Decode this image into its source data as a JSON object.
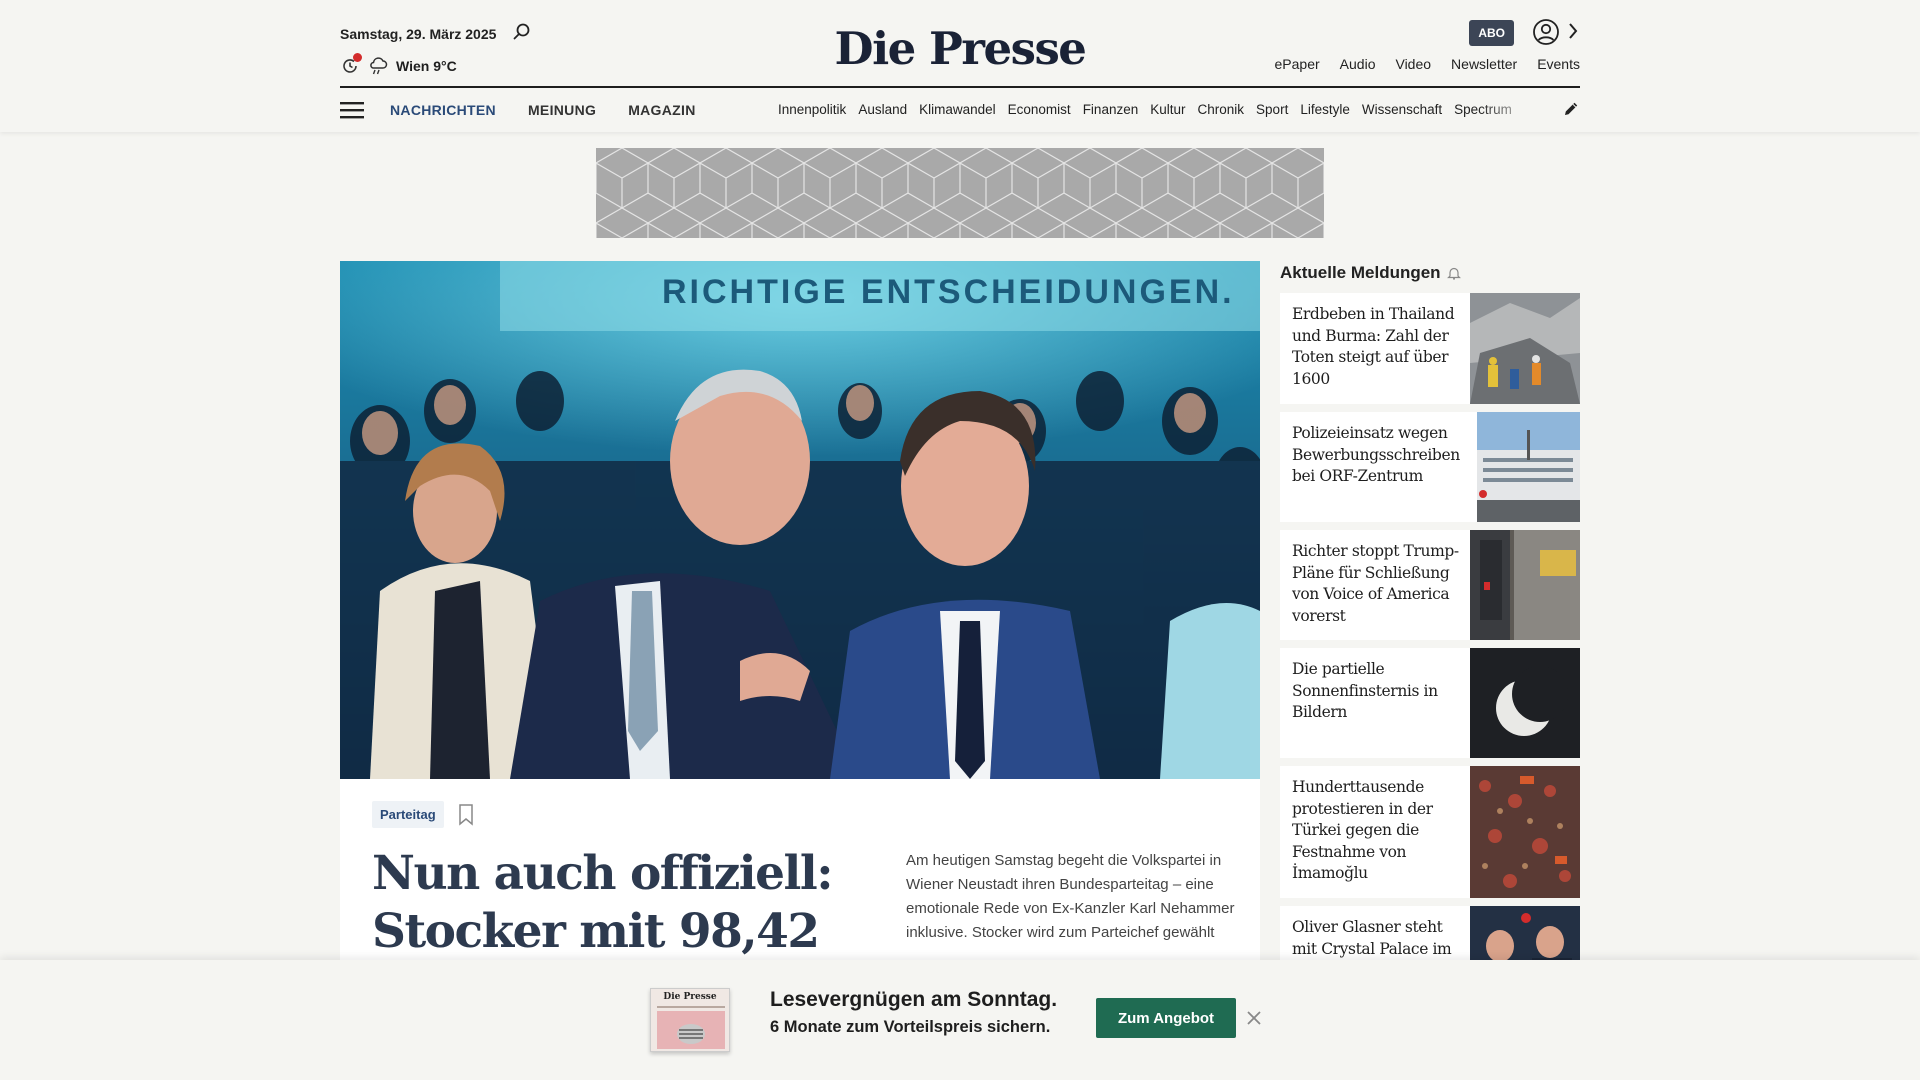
{
  "header": {
    "date": "Samstag, 29. März 2025",
    "weather": "Wien 9°C",
    "logo": "Die Presse",
    "abo_label": "ABO",
    "top_links": [
      "ePaper",
      "Audio",
      "Video",
      "Newsletter",
      "Events"
    ]
  },
  "nav": {
    "main": [
      "NACHRICHTEN",
      "MEINUNG",
      "MAGAZIN"
    ],
    "active": "NACHRICHTEN",
    "sections": [
      "Innenpolitik",
      "Ausland",
      "Klimawandel",
      "Economist",
      "Finanzen",
      "Kultur",
      "Chronik",
      "Sport",
      "Lifestyle",
      "Wissenschaft",
      "Spectrum"
    ]
  },
  "lead": {
    "tag": "Parteitag",
    "headline": "Nun auch offiziell: Stocker mit 98,42",
    "teaser": "Am heutigen Samstag begeht die Volkspartei in Wiener Neustadt ihren Bundesparteitag – eine emotionale Rede von Ex-Kanzler Karl Nehammer inklusive. Stocker wird zum Parteichef gewählt",
    "photo_banner": "RICHTIGE ENTSCHEIDUNGEN."
  },
  "sidebar": {
    "title": "Aktuelle Meldungen",
    "items": [
      {
        "title": "Erdbeben in Thailand und Burma: Zahl der Toten steigt auf über 1600"
      },
      {
        "title": "Polizeieinsatz wegen Bewerbungsschreiben bei ORF-Zentrum"
      },
      {
        "title": "Richter stoppt Trump-Pläne für Schließung von Voice of America vorerst"
      },
      {
        "title": "Die partielle Sonnenfinsternis in Bildern"
      },
      {
        "title": "Hunderttausende protestieren in der Türkei gegen die Festnahme von İmamoğlu"
      },
      {
        "title": "Oliver Glasner steht mit Crystal Palace im"
      }
    ]
  },
  "promo": {
    "headline": "Lesevergnügen am Sonntag.",
    "subline": "6 Monate zum Vorteilspreis sichern.",
    "button": "Zum Angebot",
    "mini_logo": "Die Presse"
  },
  "colors": {
    "brand_navy": "#1a2236",
    "nav_active": "#2a4a78",
    "cta_green": "#1f6b52",
    "alert_red": "#d32c2c"
  }
}
